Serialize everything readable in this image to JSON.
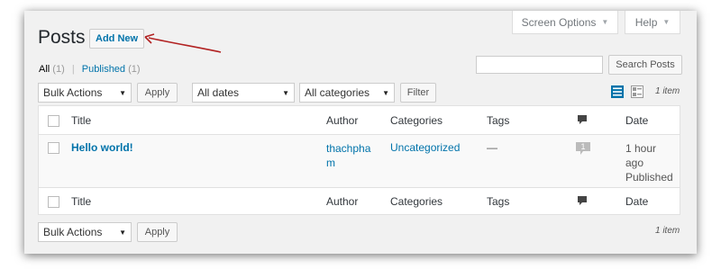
{
  "header": {
    "title": "Posts",
    "add_new_label": "Add New",
    "screen_options_label": "Screen Options",
    "help_label": "Help"
  },
  "views": {
    "all_label": "All",
    "all_count": "(1)",
    "separator": "|",
    "published_label": "Published",
    "published_count": "(1)"
  },
  "search": {
    "value": "",
    "button_label": "Search Posts"
  },
  "top_filters": {
    "bulk_actions": "Bulk Actions",
    "apply_label": "Apply",
    "dates": "All dates",
    "categories": "All categories",
    "filter_label": "Filter"
  },
  "item_count": "1 item",
  "columns": {
    "title": "Title",
    "author": "Author",
    "categories": "Categories",
    "tags": "Tags",
    "date": "Date"
  },
  "post": {
    "title": "Hello world!",
    "author_line1": "thachpha",
    "author_line2": "m",
    "category": "Uncategorized",
    "tags": "—",
    "comments": "1",
    "date_line1": "1 hour",
    "date_line2": "ago",
    "status": "Published"
  },
  "bottom_filters": {
    "bulk_actions": "Bulk Actions",
    "apply_label": "Apply"
  },
  "colors": {
    "link": "#0073aa",
    "background": "#f1f1f1",
    "arrow": "#b22222"
  },
  "icons": [
    "list-view-icon",
    "excerpt-view-icon",
    "comment-bubble-icon",
    "caret-down-icon"
  ]
}
